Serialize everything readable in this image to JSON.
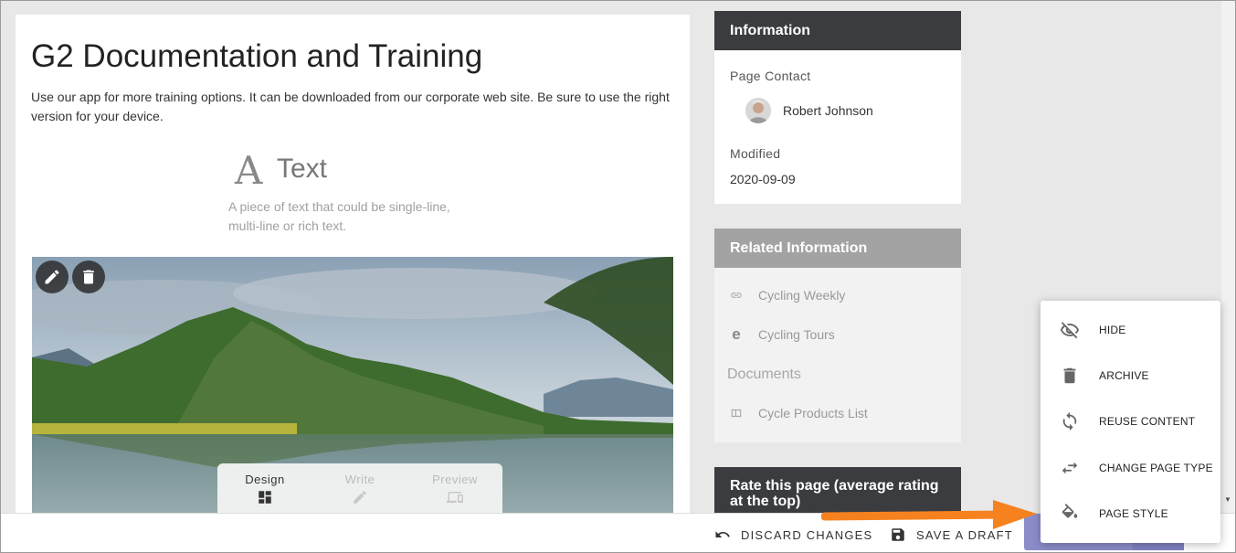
{
  "page": {
    "title": "G2 Documentation and Training",
    "intro": "Use our app for more training options. It can be downloaded from our corporate web site. Be sure to use the right version for your device."
  },
  "text_widget": {
    "icon": "A",
    "title": "Text",
    "description": "A piece of text that could be single-line, multi-line or rich text."
  },
  "image_toolbar": {
    "edit_icon": "pencil-icon",
    "delete_icon": "trash-icon"
  },
  "mode_switcher": {
    "modes": [
      {
        "label": "Design",
        "icon": "dashboard-icon",
        "active": true
      },
      {
        "label": "Write",
        "icon": "pencil-icon",
        "active": false
      },
      {
        "label": "Preview",
        "icon": "devices-icon",
        "active": false
      }
    ]
  },
  "information": {
    "header": "Information",
    "contact_label": "Page Contact",
    "contact_name": "Robert Johnson",
    "modified_label": "Modified",
    "modified_value": "2020-09-09"
  },
  "related": {
    "header": "Related Information",
    "items": [
      {
        "label": "Cycling Weekly",
        "icon": "link-icon"
      },
      {
        "label": "Cycling Tours",
        "icon": "edge-icon"
      }
    ],
    "documents_label": "Documents",
    "documents": [
      {
        "label": "Cycle Products List",
        "icon": "document-icon"
      }
    ]
  },
  "rate": {
    "header": "Rate this page (average rating at the top)"
  },
  "bottom_bar": {
    "discard_label": "DISCARD CHANGES",
    "save_label": "SAVE A DRAFT"
  },
  "menu": {
    "items": [
      {
        "label": "HIDE",
        "icon": "eye-off-icon"
      },
      {
        "label": "ARCHIVE",
        "icon": "trash-icon"
      },
      {
        "label": "REUSE CONTENT",
        "icon": "sync-icon"
      },
      {
        "label": "CHANGE PAGE TYPE",
        "icon": "swap-icon"
      },
      {
        "label": "PAGE STYLE",
        "icon": "paint-bucket-icon"
      }
    ]
  },
  "colors": {
    "panel_header": "#3a3c3f",
    "related_header": "#a3a3a3",
    "accent_arrow": "#f5821f",
    "publish_button": "#8b8dc9"
  }
}
